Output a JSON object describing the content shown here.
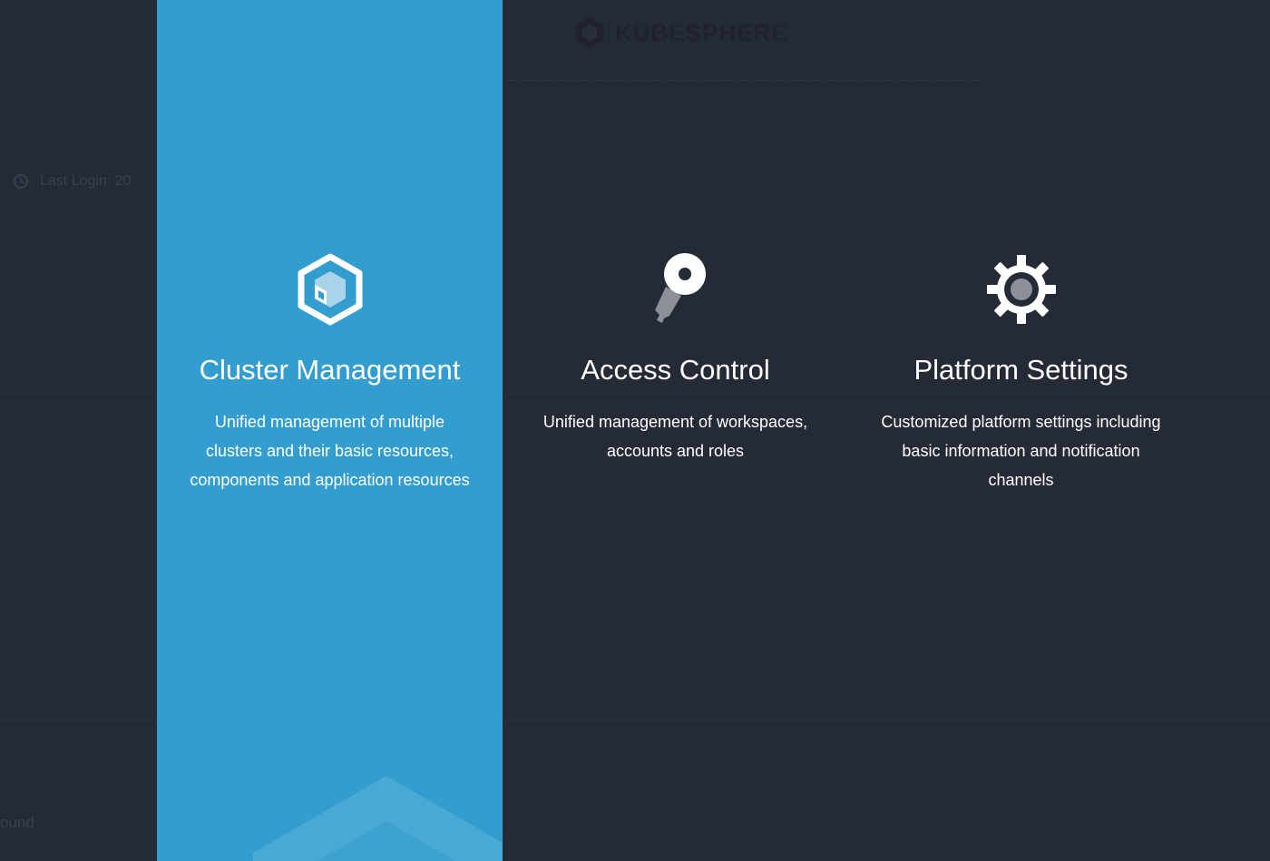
{
  "background": {
    "logo_text": "KUBESPHERE",
    "last_login_label": "Last Login: 20",
    "bottom_text": "ound"
  },
  "cards": [
    {
      "title": "Cluster Management",
      "description": "Unified management of multiple clusters and their basic resources, components and application resources",
      "icon": "cluster-hexagon-icon",
      "active": true
    },
    {
      "title": "Access Control",
      "description": "Unified management of workspaces, accounts and roles",
      "icon": "key-icon",
      "active": false
    },
    {
      "title": "Platform Settings",
      "description": "Customized platform settings including basic information and notification channels",
      "icon": "gear-icon",
      "active": false
    }
  ],
  "colors": {
    "overlay_bg": "#252a37",
    "active_card_bg": "#329dce",
    "text": "#ffffff",
    "icon_gray": "#8b9099"
  }
}
